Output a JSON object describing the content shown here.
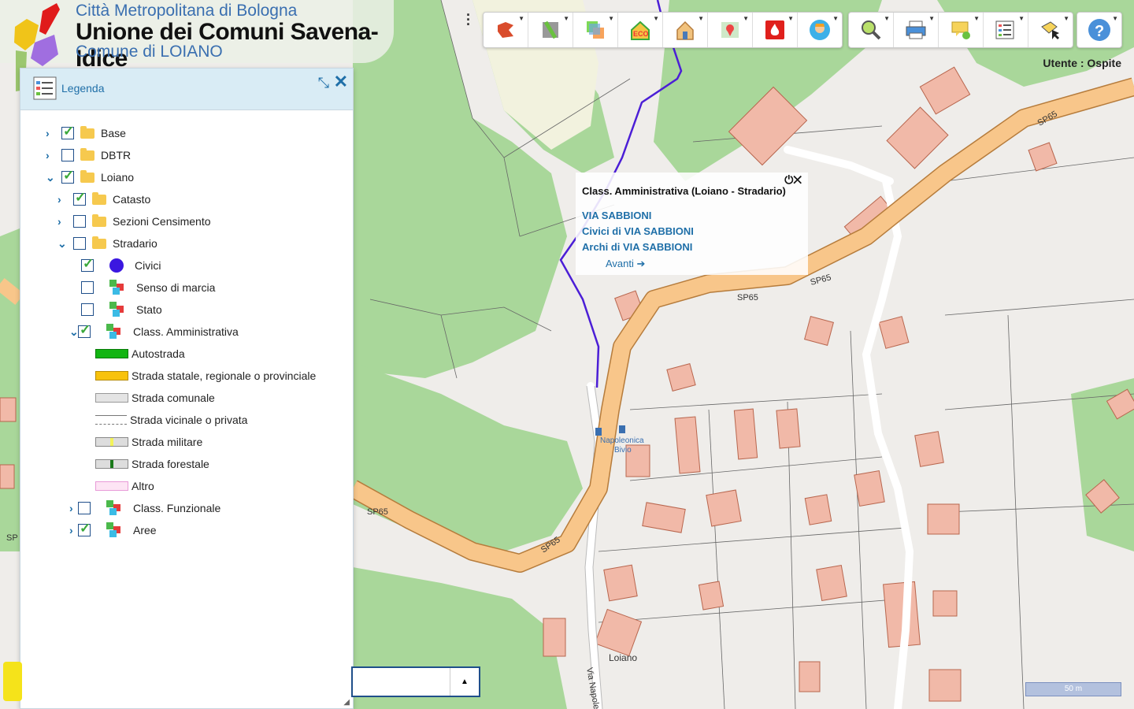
{
  "brand": {
    "line1": "Città Metropolitana di Bologna",
    "line2": "Unione dei Comuni Savena-Idice",
    "line3": "Comune di LOIANO"
  },
  "user": "Utente : Ospite",
  "toolbar_icons": [
    "map-navigation-icon",
    "road-layers-icon",
    "layers-select-icon",
    "eco-icon",
    "house-icon",
    "map-pin-icon",
    "fire-icon",
    "person-icon",
    "search-icon",
    "print-icon",
    "comment-icon",
    "report-icon",
    "edit-tool-icon",
    "help-icon"
  ],
  "legend": {
    "title": "Legenda",
    "base": "Base",
    "dbtr": "DBTR",
    "loiano": "Loiano",
    "catasto": "Catasto",
    "sezioni": "Sezioni Censimento",
    "stradario": "Stradario",
    "civici": "Civici",
    "senso": "Senso di marcia",
    "stato": "Stato",
    "class_amm": "Class. Amministrativa",
    "autostrada": "Autostrada",
    "statale": "Strada statale, regionale o provinciale",
    "comunale": "Strada comunale",
    "vicinale": "Strada vicinale o privata",
    "militare": "Strada militare",
    "forestale": "Strada forestale",
    "altro": "Altro",
    "class_funz": "Class. Funzionale",
    "aree": "Aree"
  },
  "popup": {
    "title": "Class. Amministrativa (Loiano - Stradario)",
    "link1": "VIA SABBIONI",
    "link2": "Civici di VIA SABBIONI",
    "link3": "Archi di VIA SABBIONI",
    "next": "Avanti ➔"
  },
  "map_labels": {
    "sp65": "SP65",
    "busstop": "Napoleonica Bivio",
    "town": "Loiano",
    "via": "Via Napoleo"
  },
  "scale": "50 m",
  "colors": {
    "accent": "#1f6fa8",
    "green": "#a9d79a",
    "road_orange": "#f8c68a",
    "route_purple": "#4b1ed6"
  }
}
